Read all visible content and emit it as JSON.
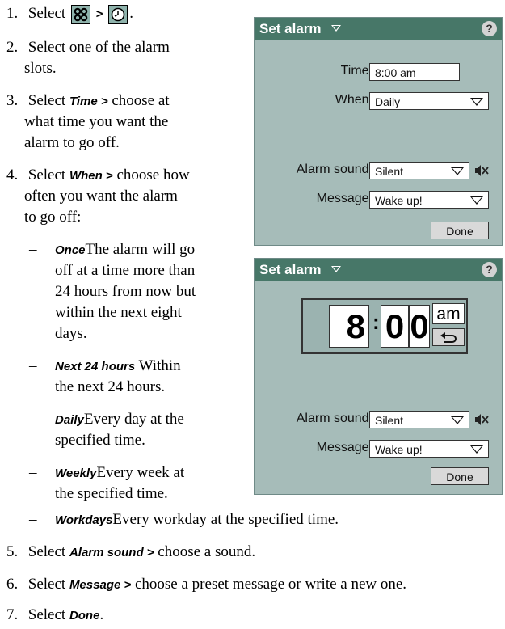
{
  "instructions": {
    "step1": {
      "num": "1.",
      "text": "Select",
      "sep": ">",
      "end": "."
    },
    "step2": {
      "num": "2.",
      "line1": "Select one of the alarm",
      "line2": "slots."
    },
    "step3": {
      "num": "3.",
      "pre": "Select",
      "kw": "Time >",
      "post": "choose at",
      "line2": "what time you want the",
      "line3": "alarm to go off."
    },
    "step4": {
      "num": "4.",
      "pre": "Select",
      "kw": "When >",
      "post": "choose how",
      "line2": "often you want the alarm",
      "line3": "to go off:"
    },
    "options": [
      {
        "kw": "Once",
        "lines": [
          "The alarm will go",
          "off at a time more than",
          "24 hours from now but",
          "within the next eight",
          "days."
        ]
      },
      {
        "kw": "Next 24 hours",
        "lines": [
          "Within",
          "the next 24 hours."
        ]
      },
      {
        "kw": "Daily",
        "lines": [
          "Every day at the",
          "specified time."
        ]
      },
      {
        "kw": "Weekly",
        "lines": [
          "Every week at",
          "the specified time."
        ]
      },
      {
        "kw": "Workdays",
        "lines": [
          "Every workday at the specified time."
        ]
      }
    ],
    "step5": {
      "num": "5.",
      "pre": "Select",
      "kw": "Alarm sound >",
      "post": "choose a sound."
    },
    "step6": {
      "num": "6.",
      "pre": "Select",
      "kw": "Message >",
      "post": "choose a preset message or write a new one."
    },
    "step7": {
      "num": "7.",
      "pre": "Select",
      "kw": "Done",
      "end": "."
    },
    "dash": "–"
  },
  "panel1": {
    "title": "Set alarm",
    "help": "?",
    "time_label": "Time:",
    "time_value": "8:00 am",
    "when_label": "When:",
    "when_value": "Daily",
    "sound_label": "Alarm sound:",
    "sound_value": "Silent",
    "message_label": "Message:",
    "message_value": "Wake up!",
    "done": "Done"
  },
  "panel2": {
    "title": "Set alarm",
    "help": "?",
    "hour": "8",
    "colon": ":",
    "min1": "0",
    "min2": "0",
    "ampm": "am",
    "sound_label": "Alarm sound:",
    "sound_value": "Silent",
    "message_label": "Message:",
    "message_value": "Wake up!",
    "done": "Done"
  },
  "colors": {
    "panel_bg": "#a6bcb9",
    "titlebar": "#477768",
    "icon_bg": "#8fb3ac"
  },
  "icons": [
    "apps-grid-icon",
    "clock-icon",
    "dropdown-arrow-icon",
    "help-icon",
    "speaker-muted-icon",
    "undo-arrow-icon"
  ]
}
